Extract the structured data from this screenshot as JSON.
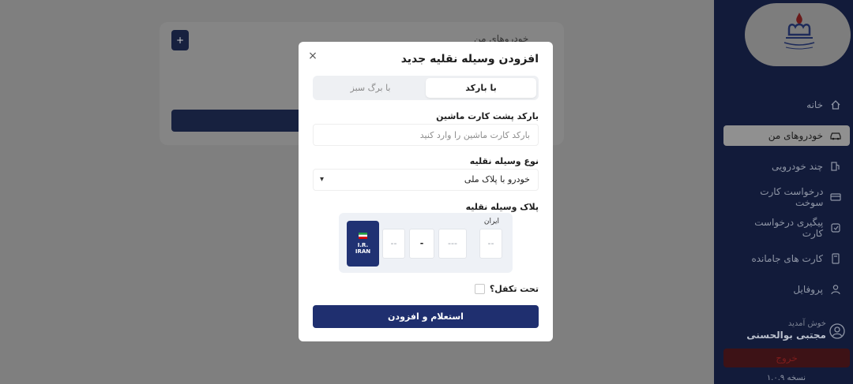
{
  "background": {
    "add_button_label": "+",
    "section_title": "خودروهای من"
  },
  "sidebar": {
    "logo_alt": "شرکت ملی پخش فرآورده‌های نفتی ایران",
    "items": [
      {
        "label": "خانه",
        "icon": "home-icon",
        "active": false
      },
      {
        "label": "خودروهای من",
        "icon": "car-icon",
        "active": true
      },
      {
        "label": "چند خودرویی",
        "icon": "fuel-pump-icon",
        "active": false
      },
      {
        "label": "درخواست کارت سوخت",
        "icon": "card-icon",
        "active": false
      },
      {
        "label": "پیگیری درخواست کارت",
        "icon": "track-icon",
        "active": false
      },
      {
        "label": "کارت های جامانده",
        "icon": "lost-card-icon",
        "active": false
      },
      {
        "label": "پروفایل",
        "icon": "user-icon",
        "active": false
      }
    ],
    "welcome": "خوش آمدید",
    "user_name": "مجتبی بوالحسنی",
    "logout_label": "خروج",
    "version": "نسخه ۱.۰.۹"
  },
  "modal": {
    "title": "افزودن وسیله نقلیه جدید",
    "close_label": "×",
    "tabs": [
      {
        "label": "با بارکد",
        "active": true
      },
      {
        "label": "با برگ سبز",
        "active": false
      }
    ],
    "barcode_label": "بارکد پشت کارت ماشین",
    "barcode_placeholder": "بارکد کارت ماشین را وارد کنید",
    "vehicle_type_label": "نوع وسیله نقلیه",
    "vehicle_type_value": "خودرو با پلاک ملی",
    "plate_label": "پلاک وسیله نقلیه",
    "plate": {
      "country_label": "ایران",
      "region": "--",
      "serial": "---",
      "letter": "-",
      "first_digits": "--",
      "flag_text_line1": "I.R.",
      "flag_text_line2": "IRAN"
    },
    "guarantee_label": "تحت تکفل؟",
    "submit_label": "استعلام و افزودن"
  },
  "colors": {
    "sidebar_bg": "#121b3a",
    "primary": "#1f2f6f",
    "plate_blue": "#203273"
  }
}
